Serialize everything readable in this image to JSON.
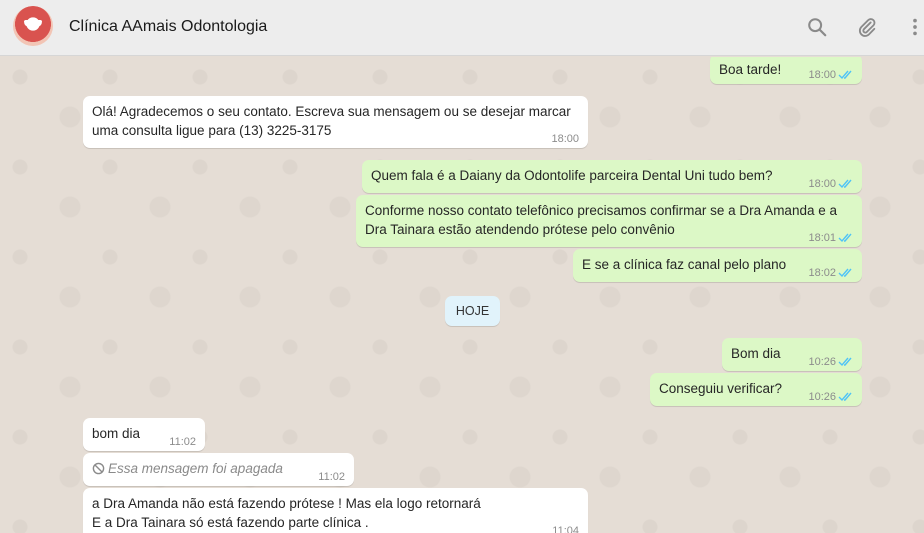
{
  "header": {
    "title": "Clínica AAmais Odontologia",
    "icons": [
      "search-icon",
      "paperclip-icon",
      "menu-icon"
    ]
  },
  "day_label": "HOJE",
  "messages": [
    {
      "dir": "out",
      "lines": [
        "Boa tarde!"
      ],
      "time": "18:00",
      "read": true
    },
    {
      "dir": "in",
      "lines": [
        "Olá! Agradecemos o seu contato. Escreva sua mensagem ou se desejar marcar",
        "uma consulta ligue para (13) 3225-3175"
      ],
      "time": "18:00"
    },
    {
      "dir": "out",
      "lines": [
        "Quem fala é a Daiany da Odontolife parceira Dental Uni tudo bem?"
      ],
      "time": "18:00",
      "read": true
    },
    {
      "dir": "out",
      "lines": [
        "Conforme nosso contato telefônico precisamos confirmar se a Dra Amanda e a",
        "Dra Tainara estão atendendo prótese pelo convênio"
      ],
      "time": "18:01",
      "read": true
    },
    {
      "dir": "out",
      "lines": [
        "E se a clínica faz canal pelo plano"
      ],
      "time": "18:02",
      "read": true
    },
    {
      "dir": "out",
      "lines": [
        "Bom dia"
      ],
      "time": "10:26",
      "read": true
    },
    {
      "dir": "out",
      "lines": [
        "Conseguiu verificar?"
      ],
      "time": "10:26",
      "read": true
    },
    {
      "dir": "in",
      "lines": [
        "bom dia"
      ],
      "time": "11:02"
    },
    {
      "dir": "in",
      "lines": [
        "Essa mensagem foi apagada"
      ],
      "time": "11:02",
      "deleted": true
    },
    {
      "dir": "in",
      "lines": [
        "a Dra Amanda não está fazendo prótese ! Mas ela logo retornará",
        "E a Dra Tainara só está fazendo parte clínica ."
      ],
      "time": "11:04"
    }
  ],
  "colors": {
    "outgoing": "#dcf8c6",
    "incoming": "#ffffff",
    "tick": "#4fc3f7",
    "background": "#e5ddd5"
  }
}
